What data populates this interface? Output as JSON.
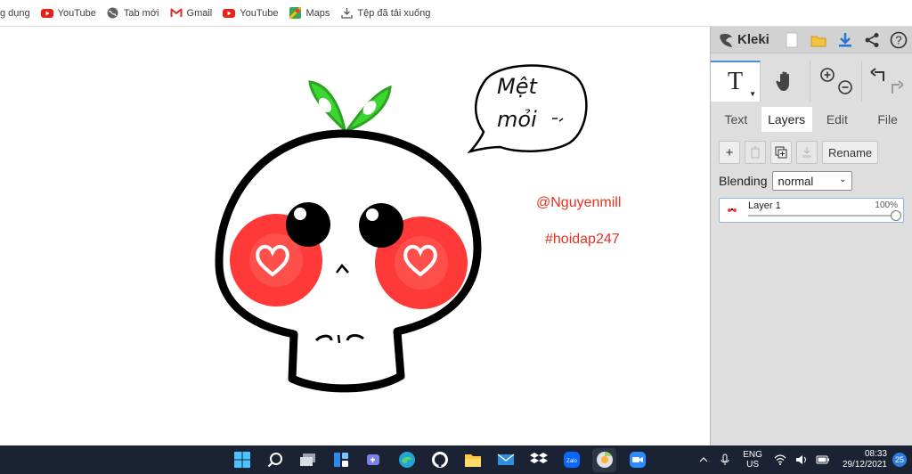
{
  "bookmarks": [
    {
      "label": "g dụng",
      "icon": "apps-icon"
    },
    {
      "label": "YouTube",
      "icon": "youtube-icon"
    },
    {
      "label": "Tab mới",
      "icon": "globe-icon"
    },
    {
      "label": "Gmail",
      "icon": "gmail-icon"
    },
    {
      "label": "YouTube",
      "icon": "youtube-icon"
    },
    {
      "label": "Maps",
      "icon": "maps-icon"
    },
    {
      "label": "Tệp đã tải xuống",
      "icon": "download-icon"
    }
  ],
  "canvas": {
    "speech_bubble": {
      "line1": "Mệt",
      "line2": "mỏi"
    },
    "handle": "@Nguyenmill",
    "hashtag": "#hoidap247"
  },
  "kleki": {
    "brand": "Kleki",
    "top_icons": [
      "new-image-icon",
      "open-folder-icon",
      "download-icon",
      "share-icon",
      "help-icon"
    ],
    "tools": {
      "text_tool": "T",
      "hand_tool": "hand-icon",
      "zoom_in": "zoom-in-icon",
      "zoom_out": "zoom-out-icon",
      "undo": "undo-icon",
      "redo": "redo-icon"
    },
    "tabs": [
      {
        "label": "Text",
        "active": false
      },
      {
        "label": "Layers",
        "active": true
      },
      {
        "label": "Edit",
        "active": false
      },
      {
        "label": "File",
        "active": false
      }
    ],
    "layer_buttons": {
      "add": "+",
      "rename": "Rename"
    },
    "blending": {
      "label": "Blending",
      "value": "normal"
    },
    "layer": {
      "name": "Layer 1",
      "opacity": "100%",
      "opacity_value": 1.0
    }
  },
  "taskbar": {
    "apps": [
      "windows-start-icon",
      "search-icon",
      "task-view-icon",
      "widgets-icon",
      "teams-icon",
      "edge-icon",
      "github-icon",
      "file-explorer-icon",
      "mail-icon",
      "dropbox-icon",
      "zalo-icon",
      "chrome-icon",
      "zoom-icon"
    ],
    "zalo_label": "Zalo",
    "language": {
      "line1": "ENG",
      "line2": "US"
    },
    "time": "08:33",
    "date": "29/12/2021",
    "notifications": "25"
  },
  "colors": {
    "accent_blue": "#4a8ad6",
    "canvas_text_red": "#e8321f",
    "taskbar_bg": "#1a2233"
  }
}
